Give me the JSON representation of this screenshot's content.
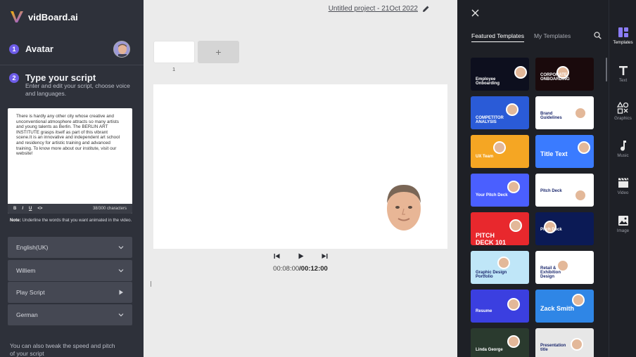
{
  "brand": {
    "name": "vidBoard.ai"
  },
  "steps": [
    {
      "num": "1",
      "title": "Avatar"
    },
    {
      "num": "2",
      "title": "Type your script",
      "desc": "Enter and edit your script, choose voice and languages."
    }
  ],
  "script": {
    "text": "There is hardly any other city whose creative and unconventional atmosphere attracts so many artists and young talents as Berlin. The BERLIN ART INSTITUTE grasps itself as part of this vibrant scene.It is an innovative and independent art school and residency for artistic training and advanced training. To know more about our institute, visit our website!",
    "toolbar": {
      "bold": "B",
      "italic": "I",
      "underline": "U",
      "code": "<>"
    },
    "char_count": "38/300 characters"
  },
  "note": {
    "label": "Note:",
    "text": " Underline the words that you want animated in the video."
  },
  "selects": [
    {
      "value": "English(UK)"
    },
    {
      "value": "Williem"
    },
    {
      "value": "Play Script"
    },
    {
      "value": "German"
    }
  ],
  "tweak_hint": "You can also tweak the speed and pitch of your script",
  "project": {
    "title": "Untitled project - 21Oct 2022"
  },
  "slides": {
    "add_label": "+",
    "items": [
      {
        "num": "1"
      }
    ]
  },
  "playback": {
    "current": "00:08:00",
    "total": "/00:12:00"
  },
  "templates": {
    "tabs": [
      {
        "label": "Featured Templates"
      },
      {
        "label": "My Templates"
      }
    ],
    "cards": [
      {
        "label": "Employee Onboarding",
        "bg": "#0d0f1e"
      },
      {
        "label": "CORPORATE ONBOARDING",
        "bg": "#1a0a0c"
      },
      {
        "label": "COMPETITOR ANALYSIS",
        "bg": "#2a5bd7"
      },
      {
        "label": "Brand Guidelines",
        "bg": "#ffffff"
      },
      {
        "label": "UX Team",
        "bg": "#f5a623"
      },
      {
        "label": "Title Text",
        "bg": "#3a7bff"
      },
      {
        "label": "Your Pitch Deck",
        "bg": "#4a5fff"
      },
      {
        "label": "Pitch Deck",
        "bg": "#ffffff"
      },
      {
        "label": "PITCH DECK 101",
        "bg": "#e8282d"
      },
      {
        "label": "Pitch Deck",
        "bg": "#0b1a55"
      },
      {
        "label": "Graphic Design Portfolio",
        "bg": "#bfe6f8"
      },
      {
        "label": "Retail & Exhibition Design",
        "bg": "#ffffff"
      },
      {
        "label": "Resume",
        "bg": "#3b3fe0"
      },
      {
        "label": "Zack Smith",
        "bg": "#2f86e6"
      },
      {
        "label": "Linda George",
        "bg": "#2a3a2e"
      },
      {
        "label": "Presentation title",
        "bg": "#e7e7e7"
      }
    ]
  },
  "sidebar": {
    "items": [
      {
        "label": "Templates"
      },
      {
        "label": "Text"
      },
      {
        "label": "Graphics"
      },
      {
        "label": "Music"
      },
      {
        "label": "Video"
      },
      {
        "label": "Image"
      }
    ]
  }
}
